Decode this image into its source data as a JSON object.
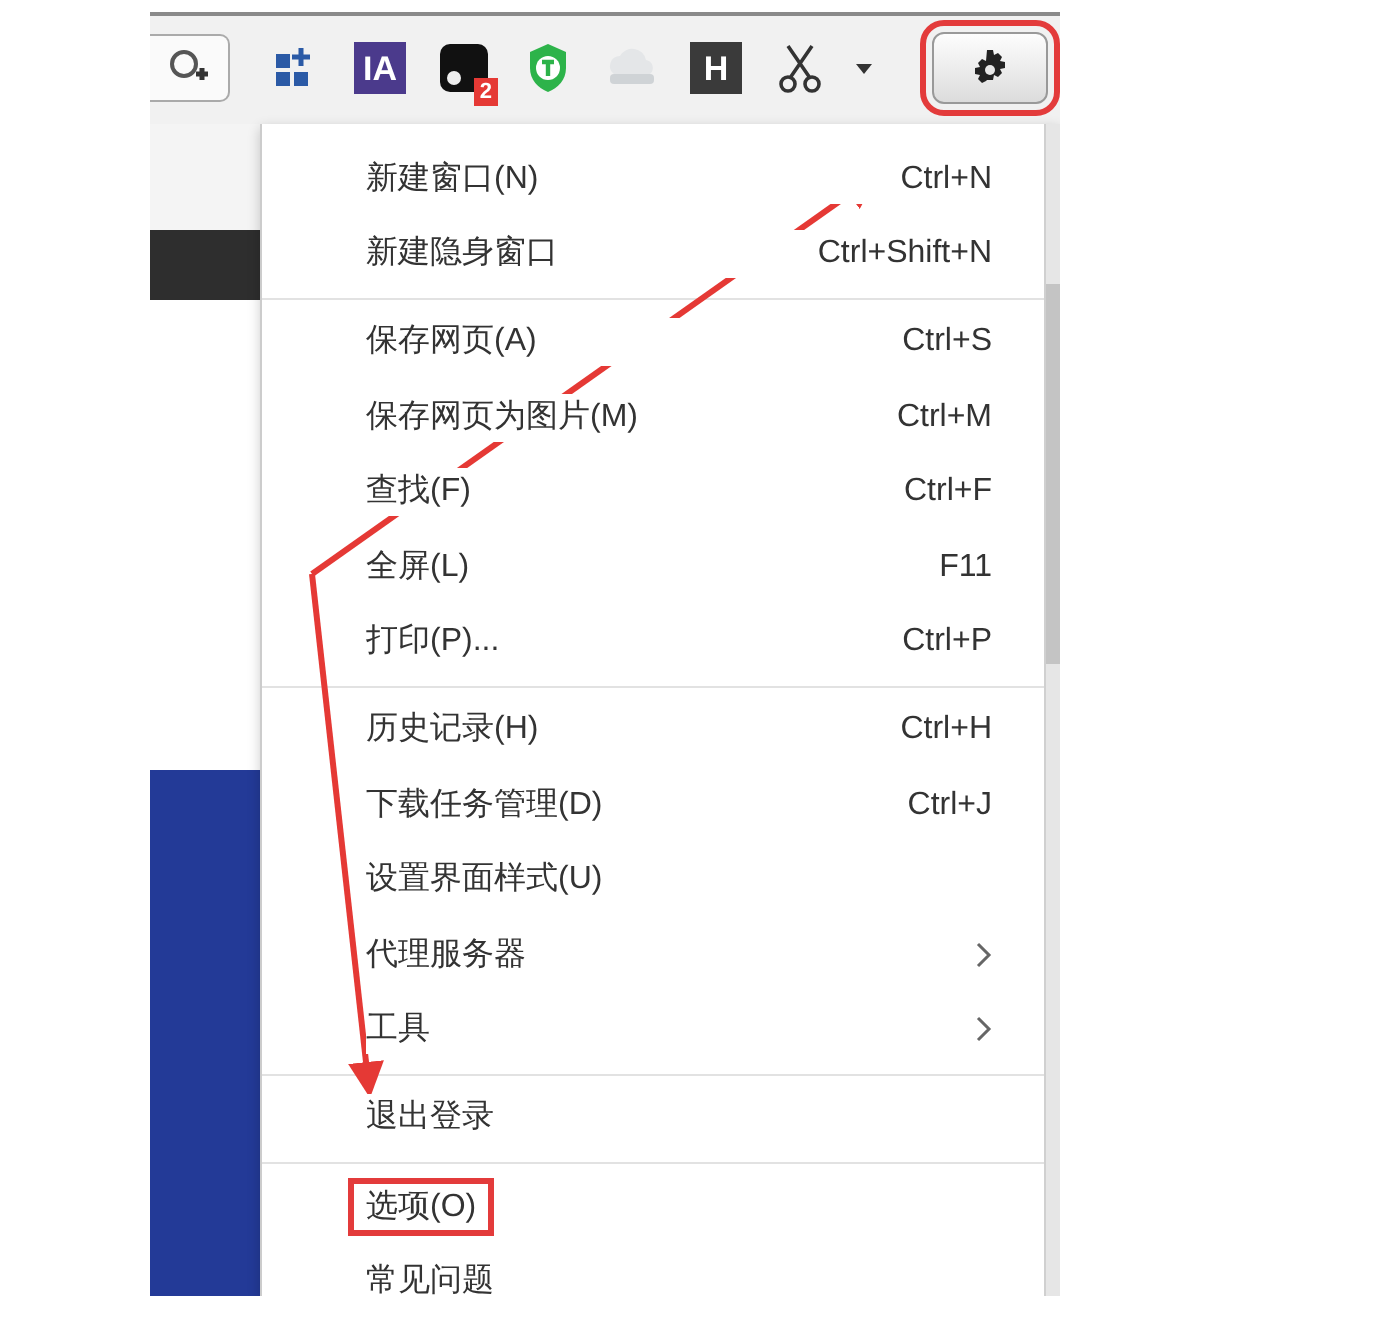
{
  "toolbar": {
    "items": [
      {
        "kind": "zoom"
      },
      {
        "kind": "apps"
      },
      {
        "kind": "text-logo",
        "label": "IA",
        "color": "#4b3a8c"
      },
      {
        "kind": "badge-logo",
        "badge": "2"
      },
      {
        "kind": "shield"
      },
      {
        "kind": "cloud"
      },
      {
        "kind": "text-logo",
        "label": "H",
        "color": "#3a3a3a"
      },
      {
        "kind": "scissors"
      },
      {
        "kind": "caret"
      },
      {
        "kind": "gear",
        "highlighted": true
      }
    ]
  },
  "menu": {
    "groups": [
      {
        "items": [
          {
            "label": "新建窗口(N)",
            "shortcut": "Ctrl+N"
          },
          {
            "label": "新建隐身窗口",
            "shortcut": "Ctrl+Shift+N"
          }
        ]
      },
      {
        "items": [
          {
            "label": "保存网页(A)",
            "shortcut": "Ctrl+S"
          },
          {
            "label": "保存网页为图片(M)",
            "shortcut": "Ctrl+M"
          },
          {
            "label": "查找(F)",
            "shortcut": "Ctrl+F"
          },
          {
            "label": "全屏(L)",
            "shortcut": "F11"
          },
          {
            "label": "打印(P)...",
            "shortcut": "Ctrl+P"
          }
        ]
      },
      {
        "items": [
          {
            "label": "历史记录(H)",
            "shortcut": "Ctrl+H"
          },
          {
            "label": "下载任务管理(D)",
            "shortcut": "Ctrl+J"
          },
          {
            "label": "设置界面样式(U)"
          },
          {
            "label": "代理服务器",
            "submenu": true
          },
          {
            "label": "工具",
            "submenu": true
          }
        ]
      },
      {
        "items": [
          {
            "label": "退出登录"
          }
        ]
      },
      {
        "items": [
          {
            "label": "选项(O)",
            "highlighted": true
          },
          {
            "label": "常见问题"
          }
        ]
      }
    ]
  }
}
